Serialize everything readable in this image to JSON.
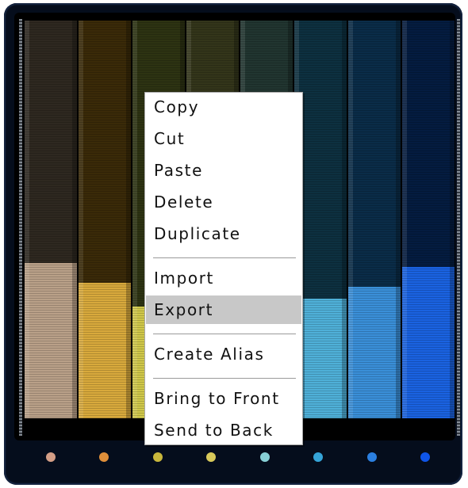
{
  "colors": {
    "frame": "#050d1c",
    "menu_highlight": "#c8c8c8"
  },
  "level_meters": [
    {
      "name": "meter-1",
      "top_color": "#2e2820",
      "level_color": "#b9a088",
      "level": 0.39,
      "dot_color": "#d49e86"
    },
    {
      "name": "meter-2",
      "top_color": "#3a2a08",
      "level_color": "#d8a93c",
      "level": 0.34,
      "dot_color": "#e08f3a"
    },
    {
      "name": "meter-3",
      "top_color": "#2d3312",
      "level_color": "#d0c84a",
      "level": 0.28,
      "dot_color": "#c9b73c"
    },
    {
      "name": "meter-4",
      "top_color": "#33351a",
      "level_color": "#d8cf66",
      "level": 0.28,
      "dot_color": "#d8c95a"
    },
    {
      "name": "meter-5",
      "top_color": "#213530",
      "level_color": "#8fd0d0",
      "level": 0.3,
      "dot_color": "#88d0d6"
    },
    {
      "name": "meter-6",
      "top_color": "#0d3040",
      "level_color": "#4fb0d8",
      "level": 0.3,
      "dot_color": "#35a4d8"
    },
    {
      "name": "meter-7",
      "top_color": "#0a2c48",
      "level_color": "#3a8fd8",
      "level": 0.33,
      "dot_color": "#2b7fe0"
    },
    {
      "name": "meter-8",
      "top_color": "#041c40",
      "level_color": "#1a62e0",
      "level": 0.38,
      "dot_color": "#0f55e8"
    }
  ],
  "context_menu": {
    "items": [
      {
        "label": "Copy",
        "highlighted": false
      },
      {
        "label": "Cut",
        "highlighted": false
      },
      {
        "label": "Paste",
        "highlighted": false
      },
      {
        "label": "Delete",
        "highlighted": false
      },
      {
        "label": "Duplicate",
        "highlighted": false
      },
      {
        "separator": true
      },
      {
        "label": "Import",
        "highlighted": false
      },
      {
        "label": "Export",
        "highlighted": true
      },
      {
        "separator": true
      },
      {
        "label": "Create Alias",
        "highlighted": false
      },
      {
        "separator": true
      },
      {
        "label": "Bring to Front",
        "highlighted": false
      },
      {
        "label": "Send to Back",
        "highlighted": false
      }
    ]
  }
}
